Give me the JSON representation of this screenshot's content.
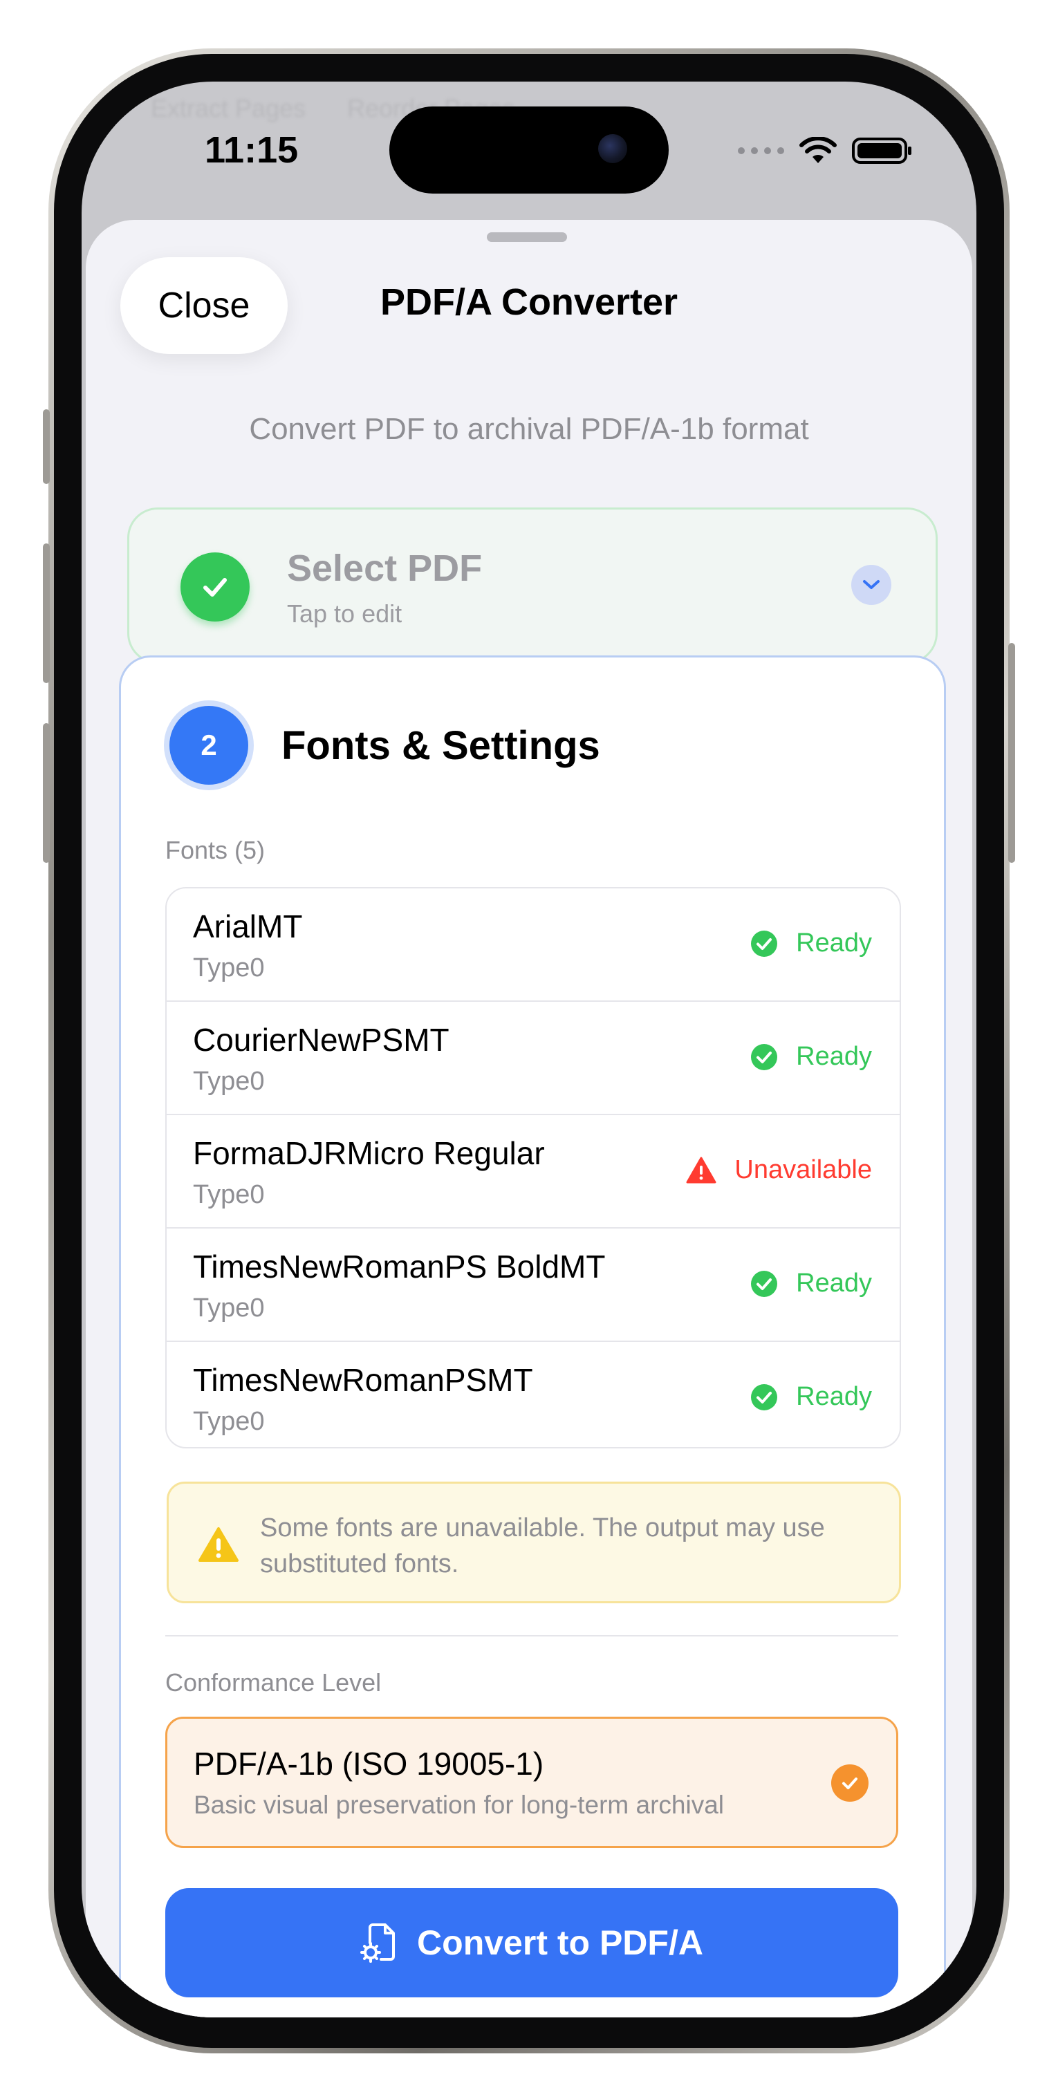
{
  "background_app": {
    "tabs": [
      "Extract Pages",
      "Reorder Pages"
    ]
  },
  "status_bar": {
    "time": "11:15"
  },
  "sheet": {
    "close_label": "Close",
    "title": "PDF/A Converter",
    "subtitle": "Convert PDF to archival PDF/A-1b format"
  },
  "step1": {
    "title": "Select PDF",
    "subtitle": "Tap to edit",
    "state": "completed"
  },
  "step2": {
    "number": "2",
    "title": "Fonts & Settings",
    "fonts_label": "Fonts (5)",
    "fonts": [
      {
        "name": "ArialMT",
        "type": "Type0",
        "status": "Ready",
        "ok": true
      },
      {
        "name": "CourierNewPSMT",
        "type": "Type0",
        "status": "Ready",
        "ok": true
      },
      {
        "name": "FormaDJRMicro Regular",
        "type": "Type0",
        "status": "Unavailable",
        "ok": false
      },
      {
        "name": "TimesNewRomanPS BoldMT",
        "type": "Type0",
        "status": "Ready",
        "ok": true
      },
      {
        "name": "TimesNewRomanPSMT",
        "type": "Type0",
        "status": "Ready",
        "ok": true
      }
    ],
    "warning_text": "Some fonts are unavailable. The output may use substituted fonts.",
    "conformance_label": "Conformance Level",
    "conformance": {
      "title": "PDF/A-1b (ISO 19005-1)",
      "subtitle": "Basic visual preservation for long-term archival",
      "selected": true
    },
    "convert_label": "Convert to PDF/A"
  },
  "colors": {
    "accent_blue": "#3673F5",
    "success_green": "#34C759",
    "error_red": "#FF3B30",
    "warning_yellow": "#F5C518",
    "selection_orange": "#F5922E"
  }
}
